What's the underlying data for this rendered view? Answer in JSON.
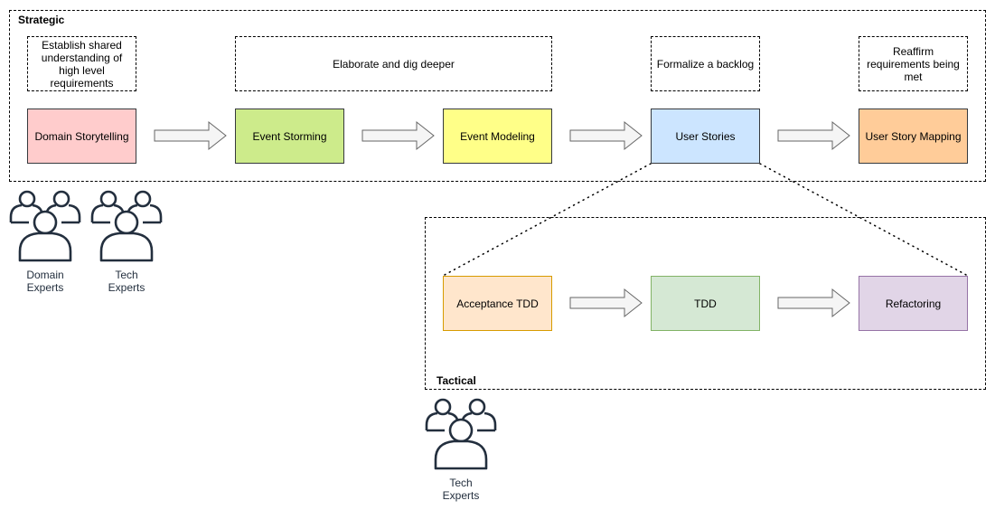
{
  "groups": {
    "strategic": {
      "title": "Strategic"
    },
    "tactical": {
      "title": "Tactical"
    }
  },
  "strategic": {
    "notes": [
      {
        "text": "Establish shared understanding of high level requirements"
      },
      {
        "text": "Elaborate and dig deeper"
      },
      {
        "text": "Formalize a backlog"
      },
      {
        "text": "Reaffirm requirements being met"
      }
    ],
    "steps": [
      {
        "label": "Domain Storytelling",
        "fill": "#ffcccc",
        "stroke": "#36393d"
      },
      {
        "label": "Event Storming",
        "fill": "#cdeb8b",
        "stroke": "#36393d"
      },
      {
        "label": "Event Modeling",
        "fill": "#ffff88",
        "stroke": "#36393d"
      },
      {
        "label": "User Stories",
        "fill": "#cce5ff",
        "stroke": "#36393d"
      },
      {
        "label": "User Story Mapping",
        "fill": "#ffcc99",
        "stroke": "#36393d"
      }
    ]
  },
  "tactical": {
    "steps": [
      {
        "label": "Acceptance TDD",
        "fill": "#ffe6cc",
        "stroke": "#d79b00"
      },
      {
        "label": "TDD",
        "fill": "#d5e8d4",
        "stroke": "#82b366"
      },
      {
        "label": "Refactoring",
        "fill": "#e1d5e7",
        "stroke": "#9673a6"
      }
    ]
  },
  "personas": [
    {
      "icon": "users-icon",
      "line1": "Domain",
      "line2": "Experts"
    },
    {
      "icon": "users-icon",
      "line1": "Tech",
      "line2": "Experts"
    },
    {
      "icon": "users-icon",
      "line1": "Tech",
      "line2": "Experts"
    }
  ],
  "colors": {
    "icon_stroke": "#232f3e",
    "arrow_fill": "#f5f5f5",
    "arrow_stroke": "#666666"
  }
}
